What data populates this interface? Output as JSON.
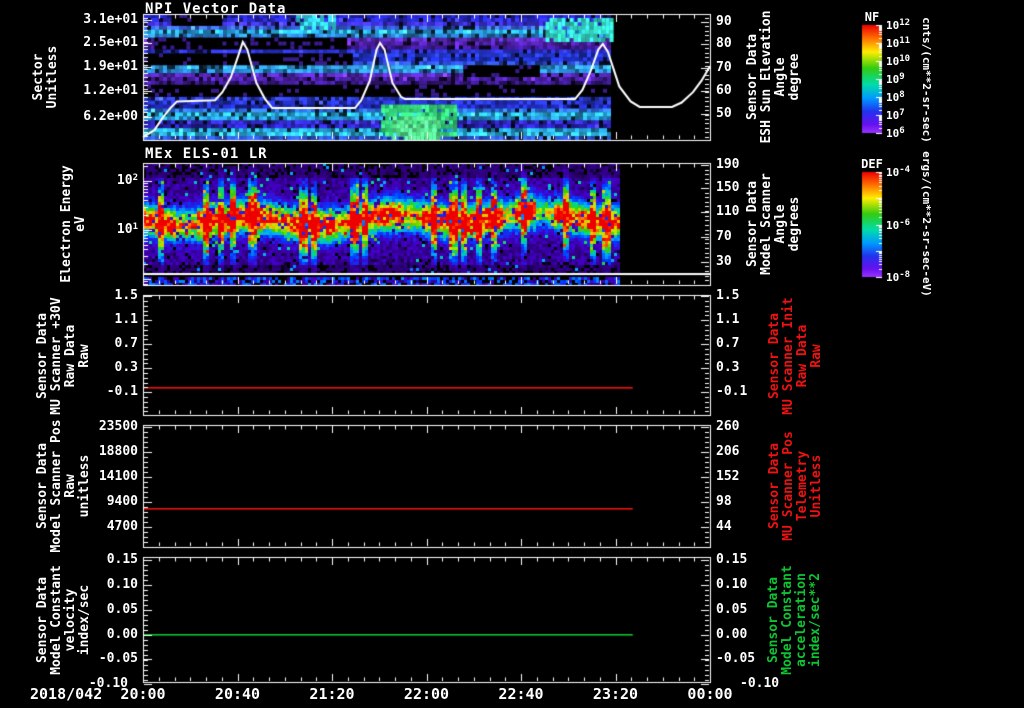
{
  "colors": {
    "background": "#000000",
    "frame": "#ffffff",
    "red_series": "#ee1212",
    "green_series": "#0ec432",
    "white_series": "#ffffff"
  },
  "x_axis": {
    "date_label": "2018/042",
    "tick_labels": [
      "20:00",
      "20:40",
      "21:20",
      "22:00",
      "22:40",
      "23:20",
      "00:00"
    ],
    "minor_subdivisions": 6
  },
  "chart_data": [
    {
      "type": "heatmap",
      "title": "NPI Vector Data",
      "left_axis": {
        "label_lines": [
          "Sector",
          "Unitless"
        ],
        "ticks": [
          [
            "3.1e+01",
            0.048
          ],
          [
            "2.5e+01",
            0.23
          ],
          [
            "1.9e+01",
            0.42
          ],
          [
            "1.2e+01",
            0.611
          ],
          [
            "6.2e+00",
            0.817
          ]
        ],
        "minor_count": 32
      },
      "right_axis": {
        "color": "#ffffff",
        "label_lines": [
          "Sensor Data",
          "ESH Sun Elevation",
          "Angle",
          "degree"
        ],
        "ticks": [
          [
            "90",
            0.063
          ],
          [
            "80",
            0.238
          ],
          [
            "70",
            0.428
          ],
          [
            "60",
            0.611
          ],
          [
            "50",
            0.794
          ]
        ],
        "minor_subdivisions": 5
      },
      "colorbar": {
        "title": "NF",
        "units": "cnts/(cm**2-sr-sec)",
        "tick_labels": [
          "10^12",
          "10^11",
          "10^10",
          "10^9",
          "10^8",
          "10^7",
          "10^6"
        ],
        "decades": 6
      },
      "heatmap": {
        "kind": "npi",
        "data_end_frac": 0.825,
        "rows": 32,
        "row_colors": [
          "#2222c4",
          "#2a2ad0",
          "#3c30d8",
          "#3860dc",
          "#28a8e2",
          "#2a86da",
          "#5c2cba",
          "#4c20a4",
          "#3c188c",
          "#2a30ca",
          "#2438d2",
          "#1e2ec2",
          "#2c4ad2",
          "#309cde",
          "#288ad6",
          "#5428b4",
          "#461e9c",
          "#381884",
          "#101028",
          "#0e0e24",
          "#141450",
          "#2c3cd2",
          "#2632ca",
          "#202aba",
          "#2c6cda",
          "#2ab2e2",
          "#2694da",
          "#3429ca",
          "#2c24c2",
          "#26a2de",
          "#2eb6e4",
          "#2c52ce"
        ],
        "black_bands": [
          [
            18,
            20,
            0.0,
            0.825
          ],
          [
            10,
            12,
            0.0,
            0.37
          ],
          [
            6,
            8,
            0.02,
            0.36
          ],
          [
            13,
            15,
            0.565,
            0.7
          ],
          [
            0,
            2,
            0.05,
            0.14
          ]
        ],
        "bright_blobs": [
          [
            1,
            6,
            0.71,
            0.825,
            "#35e0c8"
          ],
          [
            23,
            30,
            0.42,
            0.55,
            "#35d878"
          ],
          [
            26,
            31,
            0.44,
            0.52,
            "#5ae890"
          ],
          [
            0,
            3,
            0.27,
            0.34,
            "#30c8e0"
          ]
        ]
      },
      "overlay_line": {
        "name": "sun-elevation-angle",
        "color": "#ffffff",
        "deg_anchors": [
          [
            90,
            0.063
          ],
          [
            50,
            0.794
          ]
        ],
        "points_time_deg": [
          [
            0,
            40
          ],
          [
            0.02,
            43
          ],
          [
            0.035,
            48.5
          ],
          [
            0.048,
            52.5
          ],
          [
            0.06,
            55.5
          ],
          [
            0.127,
            56
          ],
          [
            0.14,
            59.5
          ],
          [
            0.155,
            66
          ],
          [
            0.169,
            76
          ],
          [
            0.176,
            81.3
          ],
          [
            0.184,
            78
          ],
          [
            0.2,
            63.5
          ],
          [
            0.215,
            56.6
          ],
          [
            0.228,
            52.6
          ],
          [
            0.374,
            52.6
          ],
          [
            0.385,
            56
          ],
          [
            0.4,
            64.5
          ],
          [
            0.412,
            78
          ],
          [
            0.418,
            80.9
          ],
          [
            0.426,
            78
          ],
          [
            0.44,
            63.5
          ],
          [
            0.455,
            57.5
          ],
          [
            0.462,
            56.5
          ],
          [
            0.762,
            56.5
          ],
          [
            0.775,
            60.5
          ],
          [
            0.79,
            69
          ],
          [
            0.803,
            78
          ],
          [
            0.811,
            80.4
          ],
          [
            0.82,
            77
          ],
          [
            0.84,
            62
          ],
          [
            0.86,
            55.5
          ],
          [
            0.876,
            53.1
          ],
          [
            0.933,
            53.1
          ],
          [
            0.95,
            55
          ],
          [
            0.97,
            59.5
          ],
          [
            0.985,
            64.5
          ],
          [
            1,
            70.8
          ]
        ]
      }
    },
    {
      "type": "heatmap",
      "title": "MEx ELS-01 LR",
      "left_axis": {
        "label_lines": [
          "Electron Energy",
          "eV"
        ],
        "ticks": [
          [
            "10^2",
            0.147
          ],
          [
            "10^1",
            0.549
          ]
        ],
        "log": true
      },
      "right_axis": {
        "color": "#ffffff",
        "label_lines": [
          "Sensor Data",
          "Model Scanner",
          "Angle",
          "degrees"
        ],
        "ticks": [
          [
            "190",
            0.016
          ],
          [
            "150",
            0.205
          ],
          [
            "110",
            0.402
          ],
          [
            "70",
            0.606
          ],
          [
            "30",
            0.811
          ]
        ],
        "minor_subdivisions": 5
      },
      "colorbar": {
        "title": "DEF",
        "units": "ergs/(cm**2-sr-sec-eV)",
        "tick_labels": [
          "10^-4",
          "10^-6",
          "10^-8"
        ],
        "decades": 4
      },
      "heatmap": {
        "kind": "els",
        "data_end_frac": 0.841,
        "band_center_frac": 0.45,
        "band_sigma_frac": 0.085,
        "amplitude_segments": [
          [
            0,
            0.02,
            0.85
          ],
          [
            0.02,
            0.055,
            1
          ],
          [
            0.055,
            0.095,
            0.72
          ],
          [
            0.095,
            0.215,
            1
          ],
          [
            0.215,
            0.26,
            0.82
          ],
          [
            0.26,
            0.335,
            1
          ],
          [
            0.335,
            0.365,
            0.78
          ],
          [
            0.365,
            0.455,
            1
          ],
          [
            0.455,
            0.49,
            0.75
          ],
          [
            0.49,
            0.63,
            1
          ],
          [
            0.63,
            0.655,
            0.6
          ],
          [
            0.655,
            0.69,
            1
          ],
          [
            0.69,
            0.72,
            0.55
          ],
          [
            0.72,
            0.841,
            0.9
          ]
        ],
        "streaks": [
          0.03,
          0.11,
          0.135,
          0.155,
          0.19,
          0.28,
          0.3,
          0.37,
          0.39,
          0.51,
          0.545,
          0.565,
          0.59,
          0.615,
          0.67,
          0.745,
          0.79,
          0.815
        ]
      },
      "overlay_line": {
        "name": "baseline",
        "color": "#ffffff",
        "y_frac": 0.902
      }
    },
    {
      "type": "line",
      "left_axis": {
        "label_lines": [
          "Sensor Data",
          "MU Scanner +30V",
          "Raw Data",
          "Raw"
        ],
        "ticks": [
          [
            "1.5",
            0.01
          ],
          [
            "1.1",
            0.21
          ],
          [
            "0.7",
            0.41
          ],
          [
            "0.3",
            0.61
          ],
          [
            "-0.1",
            0.81
          ]
        ],
        "minor_subdivisions": 5
      },
      "right_axis": {
        "color": "#ee1212",
        "label_lines": [
          "Sensor Data",
          "MU Scanner Init",
          "Raw Data",
          "Raw"
        ],
        "ticks": [
          [
            "1.5",
            0.01
          ],
          [
            "1.1",
            0.21
          ],
          [
            "0.7",
            0.41
          ],
          [
            "0.3",
            0.61
          ],
          [
            "-0.1",
            0.81
          ]
        ],
        "minor_subdivisions": 5
      },
      "series": {
        "name": "mu-scanner-30v-raw",
        "color": "#ee1212",
        "value": 0.0,
        "y_frac": 0.767,
        "x_end_frac": 0.862
      }
    },
    {
      "type": "line",
      "left_axis": {
        "label_lines": [
          "Sensor Data",
          "Model Scanner Pos",
          "Raw",
          "unitless"
        ],
        "ticks": [
          [
            "23500",
            0.016
          ],
          [
            "18800",
            0.221
          ],
          [
            "14100",
            0.426
          ],
          [
            "9400",
            0.631
          ],
          [
            "4700",
            0.836
          ]
        ],
        "minor_subdivisions": 5
      },
      "right_axis": {
        "color": "#ee1212",
        "label_lines": [
          "Sensor Data",
          "MU Scanner Pos",
          "Telemetry",
          "Unitless"
        ],
        "ticks": [
          [
            "260",
            0.016
          ],
          [
            "206",
            0.221
          ],
          [
            "152",
            0.426
          ],
          [
            "98",
            0.631
          ],
          [
            "44",
            0.836
          ]
        ],
        "minor_subdivisions": 5
      },
      "series": {
        "name": "model-scanner-pos-raw",
        "color": "#ee1212",
        "value": 8200,
        "y_frac": 0.68,
        "x_end_frac": 0.862
      }
    },
    {
      "type": "line",
      "left_axis": {
        "label_lines": [
          "Sensor Data",
          "Model Constant",
          "velocity",
          "index/sec"
        ],
        "ticks": [
          [
            "0.15",
            0.024
          ],
          [
            "0.10",
            0.224
          ],
          [
            "0.05",
            0.424
          ],
          [
            "0.00",
            0.62
          ],
          [
            "-0.05",
            0.816
          ],
          [
            "-0.10",
            1.012
          ]
        ],
        "minor_subdivisions": 5
      },
      "right_axis": {
        "color": "#0ec432",
        "label_lines": [
          "Sensor Data",
          "Model Constant",
          "acceleration",
          "index/sec**2"
        ],
        "ticks": [
          [
            "0.15",
            0.024
          ],
          [
            "0.10",
            0.224
          ],
          [
            "0.05",
            0.424
          ],
          [
            "0.00",
            0.62
          ],
          [
            "-0.05",
            0.816
          ],
          [
            "-0.10",
            1.012
          ]
        ],
        "minor_subdivisions": 5
      },
      "series": {
        "name": "model-constant-velocity",
        "color": "#0ec432",
        "value": 0.0,
        "y_frac": 0.616,
        "x_end_frac": 0.862
      }
    }
  ]
}
